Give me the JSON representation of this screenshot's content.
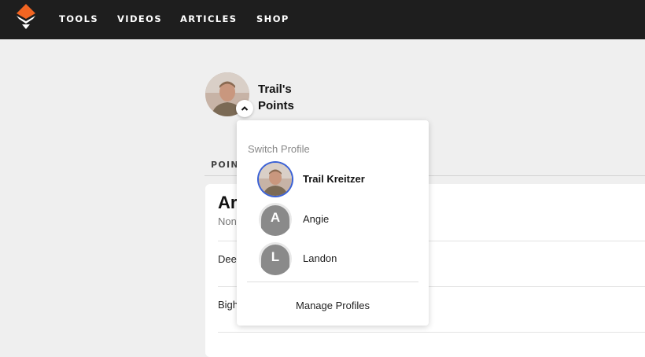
{
  "nav": {
    "logo_icon": "orange-diamond-logo-icon",
    "items": [
      "TOOLS",
      "VIDEOS",
      "ARTICLES",
      "SHOP"
    ]
  },
  "profile": {
    "title": "Trail's Points",
    "toggle_icon": "chevron-up-icon"
  },
  "tabs": {
    "active": "POINT"
  },
  "card": {
    "title": "Ar",
    "subtitle": "Non",
    "rows": [
      "Deer",
      "Bigh"
    ]
  },
  "dropdown": {
    "heading": "Switch Profile",
    "profiles": [
      {
        "name": "Trail Kreitzer",
        "initial": "",
        "selected": true
      },
      {
        "name": "Angie",
        "initial": "A",
        "selected": false
      },
      {
        "name": "Landon",
        "initial": "L",
        "selected": false
      }
    ],
    "manage_label": "Manage Profiles"
  },
  "colors": {
    "accent": "#f26522",
    "selected_ring": "#3b62d6",
    "topbar": "#1e1e1e",
    "initial_avatar": "#8a8a8a"
  }
}
